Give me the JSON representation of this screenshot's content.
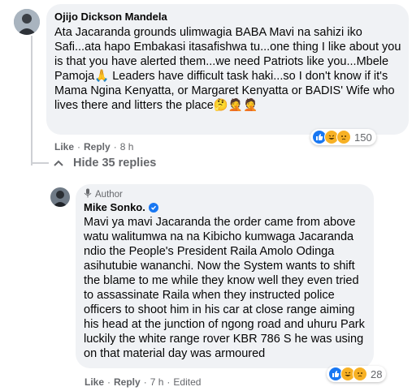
{
  "comment": {
    "author": "Ojijo Dickson Mandela",
    "text": "Ata Jacaranda grounds ulimwagia BABA Mavi na sahizi iko Safi...ata hapo Embakasi itasafishwa tu...one thing I like about you is that you have alerted them...we need Patriots like you...Mbele Pamoja🙏 Leaders have difficult task haki...so I don't know if it's Mama Ngina Kenyatta, or Margaret Kenyatta or BADIS' Wife who lives there and litters the place🤔🤦🤦",
    "actions": {
      "like": "Like",
      "sep1": "·",
      "reply": "Reply",
      "sep2": "·",
      "time": "8 h"
    },
    "reactions": {
      "count": "150",
      "icons": [
        "like-icon",
        "haha-icon",
        "sad-icon"
      ]
    }
  },
  "hide_replies": {
    "label": "Hide 35 replies"
  },
  "reply": {
    "badge": "Author",
    "author": "Mike Sonko.",
    "verified": true,
    "text": "Mavi ya mavi Jacaranda the order came from above watu walitumwa na na Kibicho kumwaga Jacaranda ndio the People's President Raila Amolo Odinga asihutubie wananchi. Now the System wants to shift the blame to me while they know well they even tried to assassinate Raila when they instructed police officers to shoot him in his car at close range aiming his head at the junction of ngong road and uhuru Park luckily the white range rover KBR 786 S he was using on that material day was armoured",
    "actions": {
      "like": "Like",
      "sep1": "·",
      "reply": "Reply",
      "sep2": "·",
      "time": "7 h",
      "sep3": "·",
      "edited": "Edited"
    },
    "reactions": {
      "count": "28",
      "icons": [
        "like-icon",
        "haha-icon",
        "sad-icon"
      ]
    }
  },
  "colors": {
    "bubble": "#f0f2f5",
    "meta": "#65676b",
    "like_blue": "#1877f2",
    "react_yellow": "#f7b125"
  }
}
